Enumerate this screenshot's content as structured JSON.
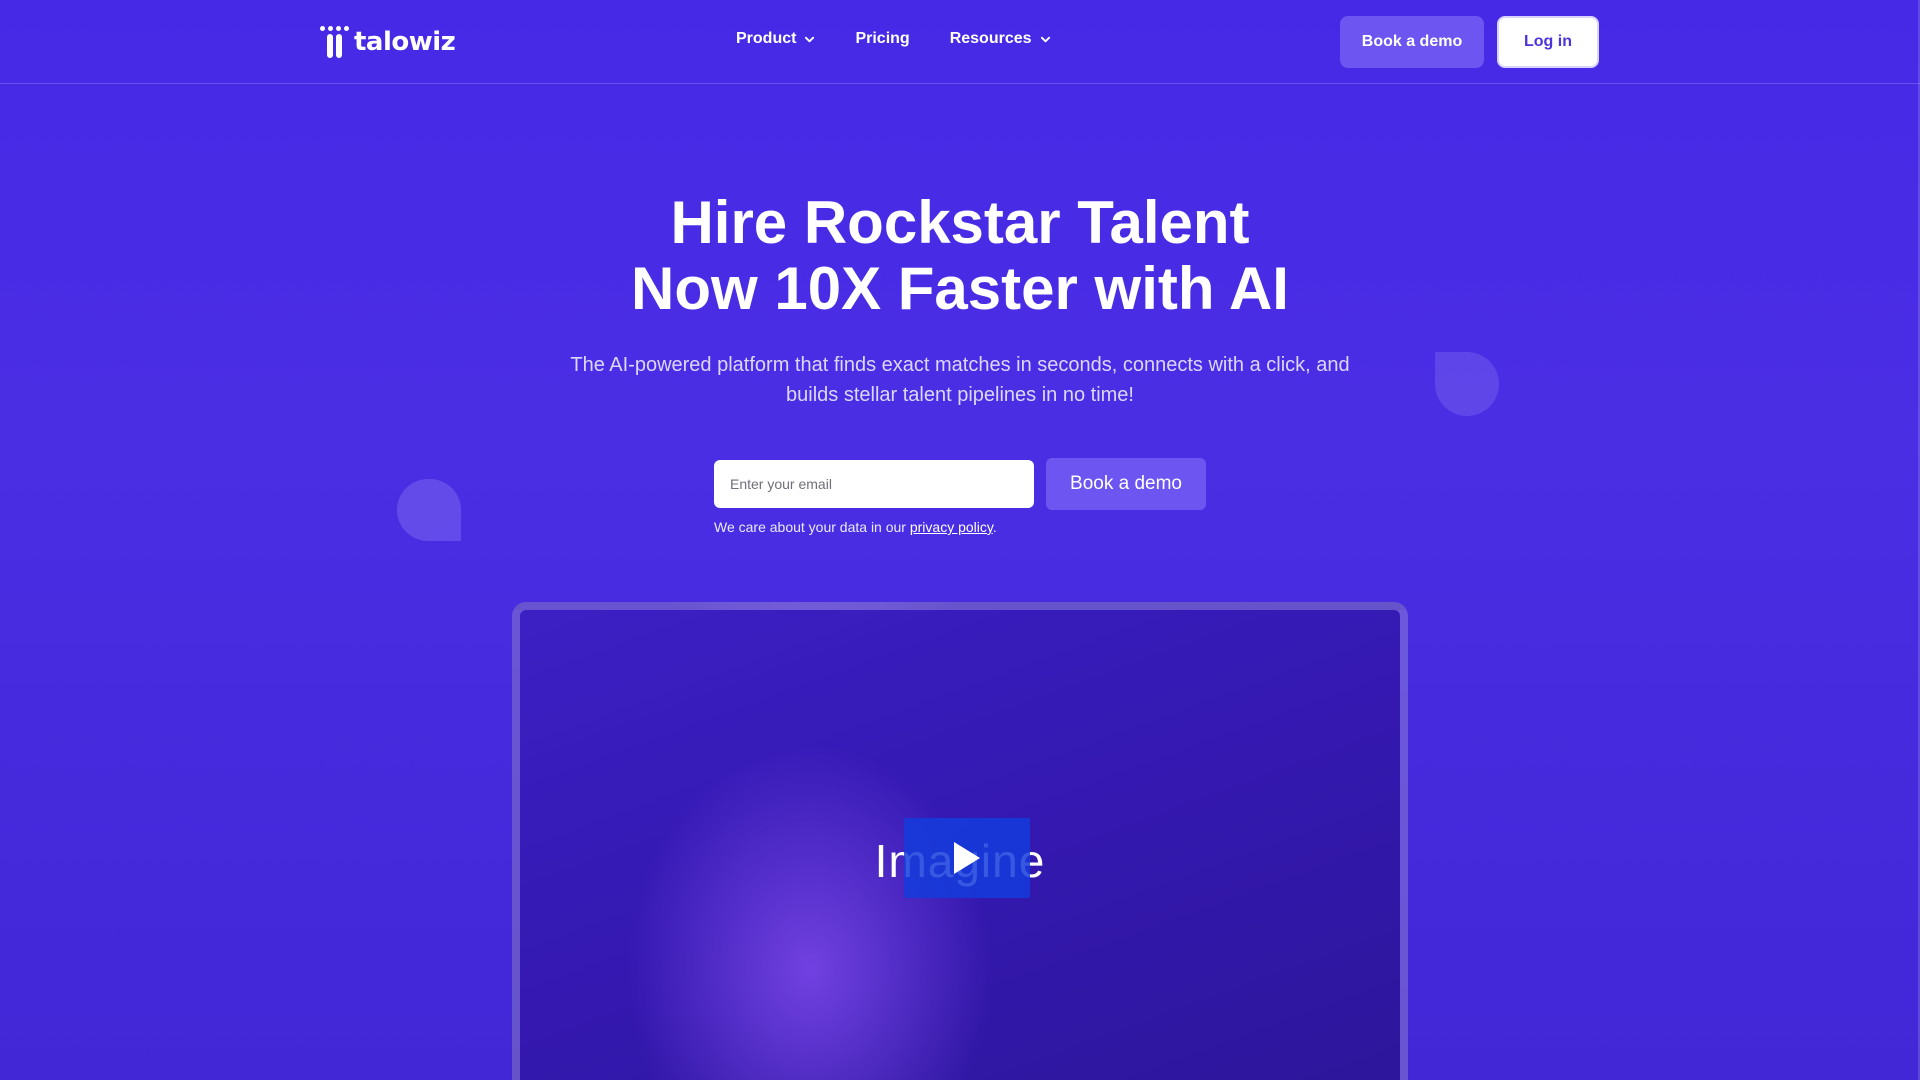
{
  "brand": {
    "name": "talowiz"
  },
  "nav": {
    "links": [
      {
        "label": "Product",
        "has_dropdown": true
      },
      {
        "label": "Pricing",
        "has_dropdown": false
      },
      {
        "label": "Resources",
        "has_dropdown": true
      }
    ],
    "book_demo_label": "Book a demo",
    "login_label": "Log in"
  },
  "hero": {
    "title_line1": "Hire Rockstar Talent",
    "title_line2": "Now 10X Faster with AI",
    "subtitle": "The AI-powered platform that finds exact matches in seconds, connects with a click, and builds stellar talent pipelines in no time!",
    "email_placeholder": "Enter your email",
    "cta_label": "Book a demo",
    "privacy_prefix": "We care about your data in our ",
    "privacy_link": "privacy policy",
    "privacy_suffix": "."
  },
  "video": {
    "overlay_text": "Imagine",
    "play_icon": "play-icon"
  },
  "colors": {
    "background": "#4629e6",
    "accent_button": "#6c55f0",
    "login_text": "#4b34dd",
    "play_button": "#143cdc"
  }
}
